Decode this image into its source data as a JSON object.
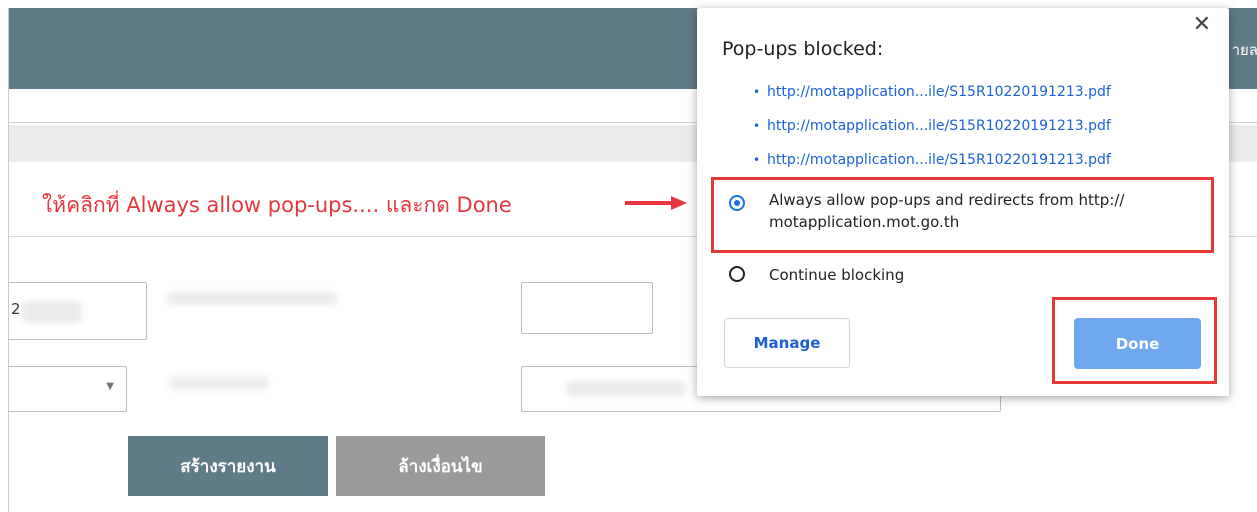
{
  "header": {
    "partial_text": "ายล"
  },
  "instruction": {
    "text": "ให้คลิกที่ Always allow pop-ups.... และกด Done"
  },
  "form": {
    "field1_value": "2",
    "create_report_label": "สร้างรายงาน",
    "clear_conditions_label": "ล้างเงื่อนไข"
  },
  "popup": {
    "title": "Pop-ups blocked:",
    "close_symbol": "✕",
    "links": [
      "http://motapplication...ile/S15R10220191213.pdf",
      "http://motapplication...ile/S15R10220191213.pdf",
      "http://motapplication...ile/S15R10220191213.pdf"
    ],
    "bullet": "•",
    "option_allow_line1": "Always allow pop-ups and redirects from http://",
    "option_allow_line2": "motapplication.mot.go.th",
    "option_block": "Continue blocking",
    "manage_label": "Manage",
    "done_label": "Done"
  },
  "colors": {
    "header_bg": "#5f7b88",
    "annotation_red": "#e8363d",
    "link_blue": "#1a62d6",
    "done_blue": "#6fa8ee"
  }
}
